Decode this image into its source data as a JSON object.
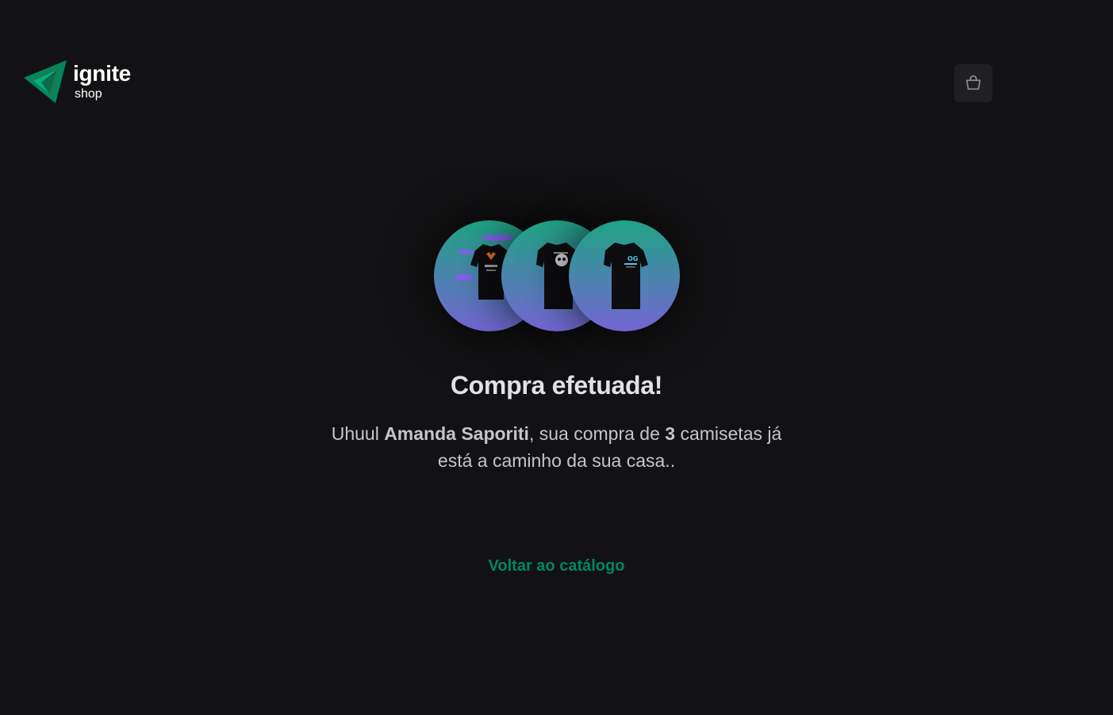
{
  "header": {
    "logo": {
      "title": "ignite",
      "subtitle": "shop",
      "icon": "ignite-logo-icon"
    },
    "cart": {
      "icon": "shopping-bag-icon"
    }
  },
  "success": {
    "products": [
      {
        "icon": "tshirt-icon",
        "variant": "purple-planet-print"
      },
      {
        "icon": "tshirt-icon",
        "variant": "skull-print"
      },
      {
        "icon": "tshirt-icon",
        "variant": "blue-logo-print"
      }
    ],
    "title": "Compra efetuada!",
    "message": {
      "prefix": "Uhuul ",
      "customer_name": "Amanda Saporiti",
      "middle": ", sua compra de ",
      "quantity": "3",
      "suffix": " camisetas já está a caminho da sua casa.."
    },
    "back_link_label": "Voltar ao catálogo"
  },
  "colors": {
    "background": "#121214",
    "accent": "#00875f",
    "gradient_start": "#1ea483",
    "gradient_end": "#7465d4",
    "cart_button_bg": "#202024"
  }
}
